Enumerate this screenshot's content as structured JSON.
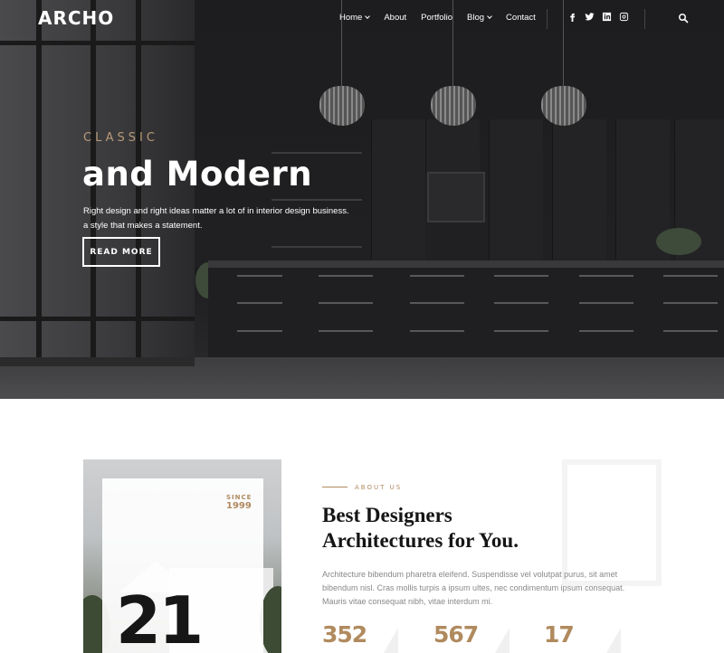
{
  "nav": {
    "logo": "ARCHO",
    "items": [
      {
        "label": "Home",
        "has_dropdown": true
      },
      {
        "label": "About",
        "has_dropdown": false
      },
      {
        "label": "Portfolio",
        "has_dropdown": false
      },
      {
        "label": "Blog",
        "has_dropdown": true
      },
      {
        "label": "Contact",
        "has_dropdown": false
      }
    ],
    "social_icons": [
      "facebook-icon",
      "twitter-icon",
      "linkedin-icon",
      "instagram-icon"
    ],
    "search_icon": "search-icon"
  },
  "hero": {
    "kicker": "CLASSIC",
    "title": "and Modern",
    "description_line1": "Right design and right ideas matter a lot of in interior design business.",
    "description_line2": "a style that makes a statement.",
    "button_label": "READ MORE"
  },
  "about": {
    "since_label": "SINCE",
    "since_year": "1999",
    "years_number": "21",
    "kicker": "ABOUT US",
    "title_line1": "Best Designers",
    "title_line2": "Architectures for You.",
    "text": "Architecture bibendum pharetra eleifend. Suspendisse vel volutpat purus, sit amet bibendum nisl. Cras mollis turpis a ipsum ultes, nec condimentum ipsum consequat. Mauris vitae consequat nibh, vitae interdum mi.",
    "stats": [
      "352",
      "567",
      "17"
    ]
  },
  "colors": {
    "accent": "#b08a5e",
    "hero_kicker": "#b89a78",
    "dark": "#161616"
  }
}
